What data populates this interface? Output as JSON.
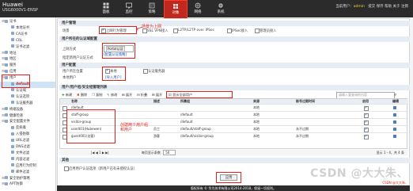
{
  "header": {
    "brand": "Huawei",
    "model": "USG6000V1-ENSP",
    "nav": [
      {
        "label": "面板",
        "icon": "dashboard-icon"
      },
      {
        "label": "监控",
        "icon": "monitor-icon"
      },
      {
        "label": "策略",
        "icon": "policy-icon"
      },
      {
        "label": "对象",
        "icon": "object-icon"
      },
      {
        "label": "网络",
        "icon": "network-icon"
      },
      {
        "label": "系统",
        "icon": "system-icon"
      }
    ],
    "user_prefix": "当前用户：",
    "user": "admin",
    "links": "提交  保存  帮助  关于  注销"
  },
  "sidebar": {
    "items": [
      {
        "label": "证书",
        "level": 0
      },
      {
        "label": "本地证书",
        "level": 1
      },
      {
        "label": "CA证书",
        "level": 1
      },
      {
        "label": "CRL",
        "level": 1
      },
      {
        "label": "证书过滤",
        "level": 1
      },
      {
        "label": "地址",
        "level": 0
      },
      {
        "label": "地区",
        "level": 0
      },
      {
        "label": "服务",
        "level": 0
      },
      {
        "label": "应用",
        "level": 0
      },
      {
        "label": "用户",
        "level": 0
      },
      {
        "label": "default",
        "level": 1
      },
      {
        "label": "认证域",
        "level": 1
      },
      {
        "label": "认证选项",
        "level": 1
      },
      {
        "label": "认证服务器",
        "level": 1
      },
      {
        "label": "终端设备",
        "level": 0
      },
      {
        "label": "健康检查",
        "level": 0
      },
      {
        "label": "安全配置文件",
        "level": 0
      },
      {
        "label": "反病毒",
        "level": 1
      },
      {
        "label": "入侵防御",
        "level": 1
      },
      {
        "label": "URL过滤",
        "level": 1
      },
      {
        "label": "DNS过滤",
        "level": 1
      },
      {
        "label": "文件过滤",
        "level": 1
      },
      {
        "label": "内容过滤",
        "level": 1
      },
      {
        "label": "应用行为控制",
        "level": 1
      },
      {
        "label": "邮件过滤",
        "level": 1
      },
      {
        "label": "安全防护策略",
        "level": 0
      },
      {
        "label": "APT防御",
        "level": 0
      }
    ]
  },
  "main": {
    "section_user_mgmt": "用户管理",
    "scene_label": "场景",
    "scene_options": [
      "上网行为管理",
      "SSL VPN接入",
      "L2TP/L2TP over IPSec",
      "IPSec接入",
      "管理员接入"
    ],
    "annot_scene": "场景为上网",
    "section_auth_domain": "用户所在的认证域配置",
    "access_label": "上网方式",
    "access_value": "Portal认证",
    "access_link": "[配置认证策略]",
    "new_user_label": "指定新用户认证方式",
    "section_user_pos": "用户配置",
    "user_pos_label": "用户所在位置",
    "user_pos_local": "本地",
    "user_pos_server": "认证服务器",
    "local_user_label": "本地用户",
    "import_link": "[导入用户]",
    "section_list": "用户/用户组/安全组管理列表",
    "toolbar": {
      "new": "新建",
      "delete": "删除",
      "copy": "复制",
      "modify": "修改",
      "expand": "展开",
      "collapse": "折叠",
      "expand_all": "展开",
      "show_all": "显示全部用户",
      "query_filter": "请输入要查询的内容"
    },
    "annot_create": "创建两个用户组\n和用户",
    "columns": [
      "名称",
      "描述",
      "所属组",
      "来源",
      "账号过期时间",
      "启用",
      "编辑"
    ],
    "rows": [
      {
        "name": "/default",
        "desc": "",
        "group": "",
        "source": "本地",
        "expire": "",
        "enabled": true
      },
      {
        "name": "staff-group",
        "desc": "",
        "group": "/default",
        "source": "本地",
        "expire": "",
        "enabled": true
      },
      {
        "name": "visitor-group",
        "desc": "",
        "group": "/default",
        "source": "本地",
        "expire": "",
        "enabled": true
      },
      {
        "name": "user001(Hubewen)",
        "desc": "员工",
        "group": "/default/staff-group",
        "source": "本地",
        "expire": "永不过期",
        "enabled": true
      },
      {
        "name": "guest001(访客)",
        "desc": "游客",
        "group": "/default/visitor-group",
        "source": "本地",
        "expire": "永不过期",
        "enabled": true
      }
    ],
    "pager": {
      "per_page": "每页显示条数",
      "per_page_value": "50",
      "info": "显示 1 - 4，共 4 条"
    },
    "section_other": "其他",
    "portal_option": "启用用户认证选项（新用户已有未授权认证）",
    "apply": "应用"
  },
  "footer": "版权所有 © 华为技术有限公司2014-2018，保留一切权利。",
  "watermark": "CSDN @大大朱、",
  "watermark_sub": "CSDN @大大朱、"
}
